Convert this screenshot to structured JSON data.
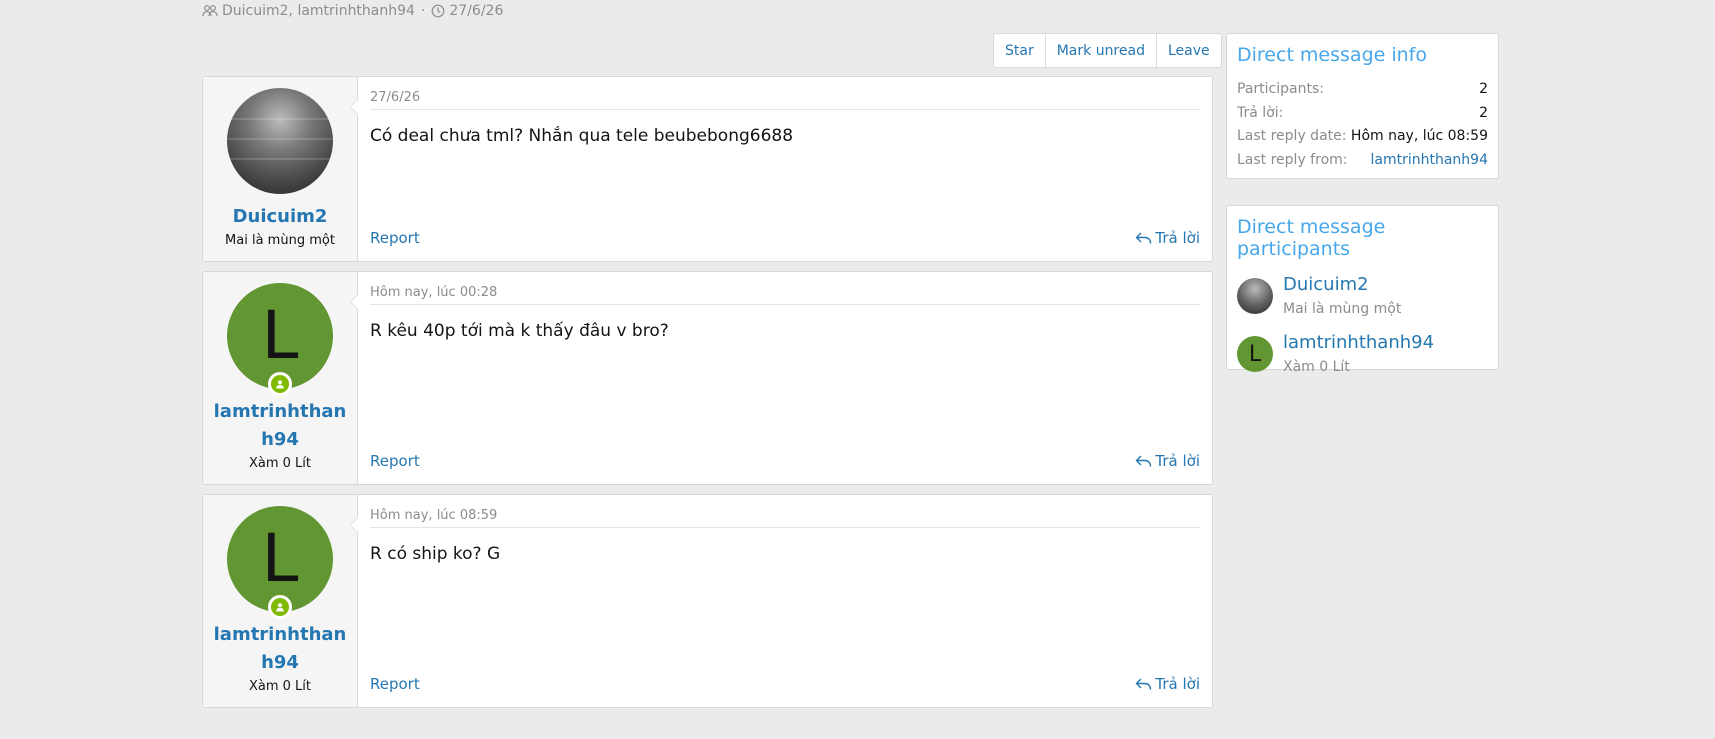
{
  "thread": {
    "participants_label": "Duicuim2, lamtrinhthanh94",
    "separator": "·",
    "start_date": "27/6/26"
  },
  "actions": {
    "star": "Star",
    "mark_unread": "Mark unread",
    "leave": "Leave"
  },
  "messages": [
    {
      "date": "27/6/26",
      "author": "Duicuim2",
      "user_title": "Mai là mùng một",
      "text": "Có deal chưa tml? Nhắn qua tele beubebong6688",
      "report": "Report",
      "reply": "Trả lời",
      "avatar_letter": ""
    },
    {
      "date": "Hôm nay, lúc 00:28",
      "author": "lamtrinhthanh94",
      "user_title": "Xàm 0 Lít",
      "text": "R kêu 40p tới mà k thấy đâu v bro?",
      "report": "Report",
      "reply": "Trả lời",
      "avatar_letter": "L"
    },
    {
      "date": "Hôm nay, lúc 08:59",
      "author": "lamtrinhthanh94",
      "user_title": "Xàm 0 Lít",
      "text": "R có ship ko? G",
      "report": "Report",
      "reply": "Trả lời",
      "avatar_letter": "L"
    }
  ],
  "info": {
    "title": "Direct message info",
    "rows": [
      {
        "key": "Participants:",
        "value": "2"
      },
      {
        "key": "Trả lời:",
        "value": "2"
      },
      {
        "key": "Last reply date:",
        "value": "Hôm nay, lúc 08:59"
      },
      {
        "key": "Last reply from:",
        "value": "lamtrinhthanh94"
      }
    ]
  },
  "participants": {
    "title": "Direct message participants",
    "list": [
      {
        "name": "Duicuim2",
        "title": "Mai là mùng một",
        "avatar_letter": ""
      },
      {
        "name": "lamtrinhthanh94",
        "title": "Xàm 0 Lít",
        "avatar_letter": "L"
      }
    ]
  },
  "colors": {
    "link": "#2577b1",
    "heading": "#47a7eb",
    "avatar_green": "#629632",
    "online": "#7fb900",
    "background": "#ebebeb"
  },
  "icons": {
    "participants": "users-icon",
    "date": "clock-icon",
    "reply": "reply-icon",
    "online": "user-online-icon"
  }
}
